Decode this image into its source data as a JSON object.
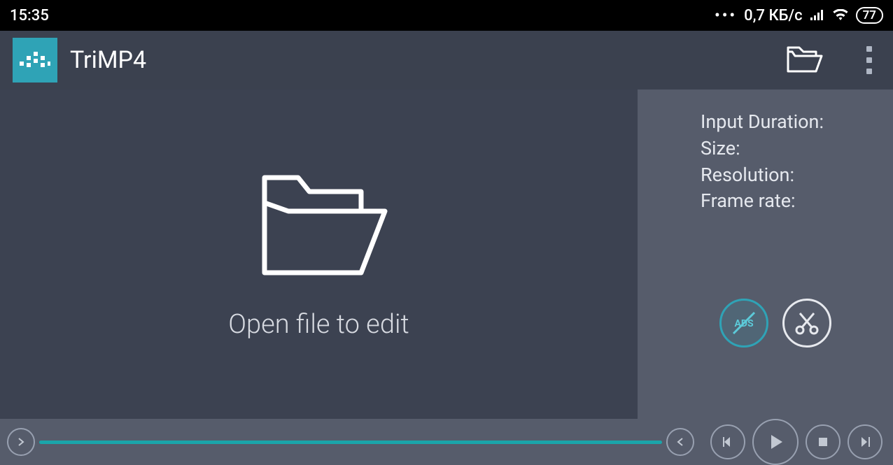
{
  "status": {
    "time": "15:35",
    "net_speed": "0,7 КБ/с",
    "battery": "77"
  },
  "app": {
    "title": "TriMP4"
  },
  "preview": {
    "open_label": "Open file to edit"
  },
  "info": {
    "duration_label": "Input Duration:",
    "size_label": "Size:",
    "resolution_label": "Resolution:",
    "framerate_label": "Frame rate:"
  },
  "ads": {
    "label": "ADS"
  }
}
